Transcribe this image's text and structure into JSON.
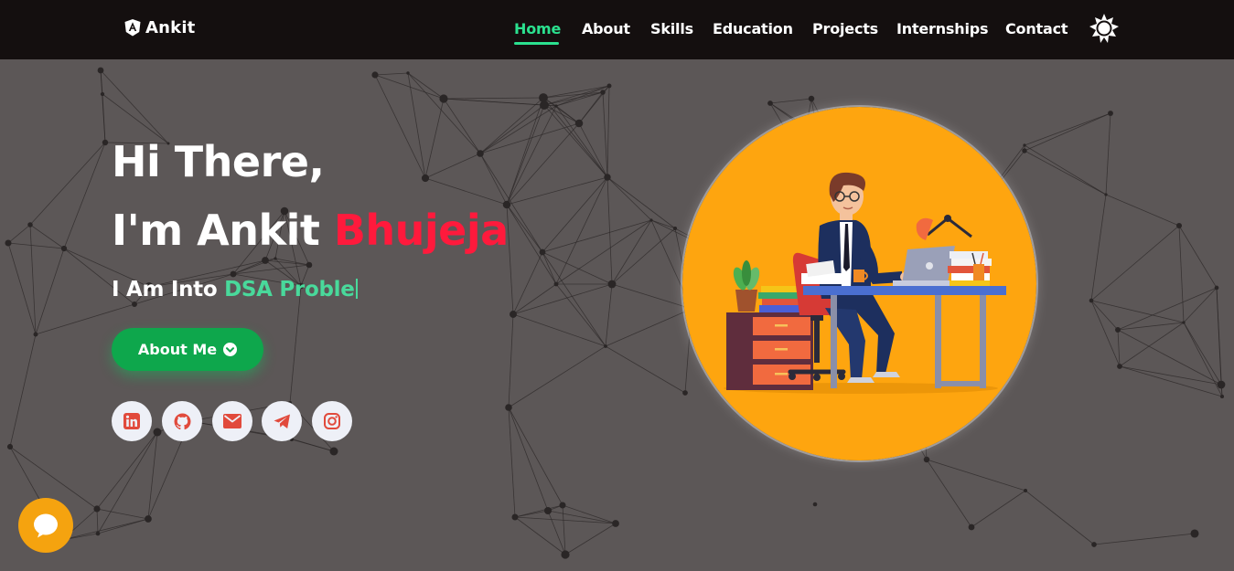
{
  "brand": {
    "name": "Ankit",
    "icon": "angular-shield-icon"
  },
  "nav": {
    "items": [
      {
        "label": "Home",
        "active": true
      },
      {
        "label": "About"
      },
      {
        "label": "Skills"
      },
      {
        "label": "Education"
      },
      {
        "label": "Projects"
      },
      {
        "label": "Internships"
      },
      {
        "label": "Contact"
      }
    ],
    "theme_toggle_icon": "sun-icon"
  },
  "hero": {
    "greeting": "Hi There,",
    "intro": "I'm Ankit",
    "surname": "Bhujeja",
    "subtitle_prefix": "I Am Into",
    "subtitle_typed": "DSA Proble",
    "about_button": "About Me",
    "about_button_icon": "chevron-down-circle-icon"
  },
  "social": [
    {
      "name": "linkedin-icon"
    },
    {
      "name": "github-icon"
    },
    {
      "name": "mail-icon"
    },
    {
      "name": "telegram-icon"
    },
    {
      "name": "instagram-icon"
    }
  ],
  "colors": {
    "background": "#5c5757",
    "navbar": "#140f0f",
    "nav_active": "#2be18f",
    "surname": "#ff1a3c",
    "typed_text": "#49d99b",
    "about_button": "#0ea74c",
    "illustration_circle": "#fea50f",
    "chat_button": "#f5a30f",
    "social_icon": "#e14a3c"
  },
  "illustration": {
    "subject": "developer-at-desk-illustration"
  },
  "chat": {
    "icon": "chat-bubble-icon"
  }
}
